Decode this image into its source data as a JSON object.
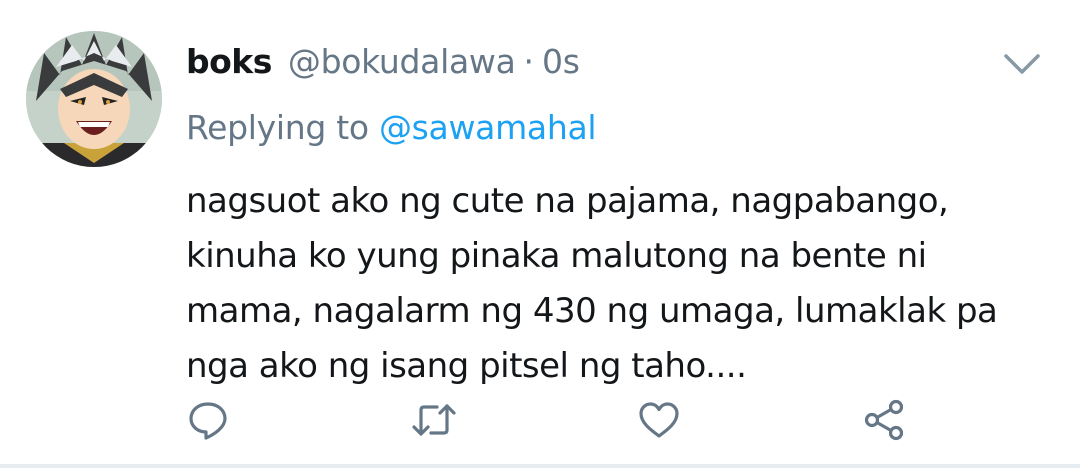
{
  "tweet": {
    "author_name": "boks",
    "author_handle": "@bokudalawa",
    "separator": "·",
    "timestamp": "0s",
    "replying_prefix": "Replying to",
    "replying_to": "@sawamahal",
    "body_lines": [
      "nagsuot ako ng cute na pajama, nagpabango,",
      "kinuha ko yung pinaka malutong na bente ni",
      "mama, nagalarm ng 430 ng umaga, lumaklak pa",
      "nga ako ng isang pitsel ng taho...."
    ]
  },
  "icons": {
    "menu": "chevron-down-icon",
    "reply": "reply-icon",
    "retweet": "retweet-icon",
    "like": "heart-icon",
    "share": "share-icon"
  },
  "colors": {
    "text_primary": "#14171a",
    "text_secondary": "#657786",
    "link": "#1da1f2",
    "icon": "#657786",
    "divider": "#e6ecf0"
  }
}
